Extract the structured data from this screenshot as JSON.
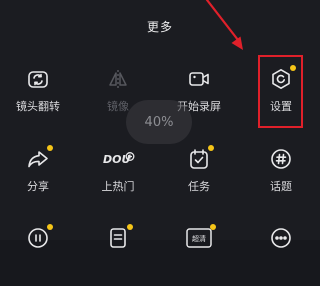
{
  "sheet": {
    "title": "更多"
  },
  "overlay": {
    "progress": "40%"
  },
  "row1": [
    {
      "label": "镜头翻转",
      "icon": "camera-flip-icon",
      "enabled": true
    },
    {
      "label": "镜像",
      "icon": "mirror-icon",
      "enabled": false
    },
    {
      "label": "开始录屏",
      "icon": "screen-record-icon",
      "enabled": true
    },
    {
      "label": "设置",
      "icon": "settings-hexagon-icon",
      "enabled": true,
      "badge": true
    }
  ],
  "row2": [
    {
      "label": "分享",
      "icon": "share-arrow-icon",
      "badge": true
    },
    {
      "label": "上热门",
      "icon": "dou-plus-icon",
      "icon_text": "DOU"
    },
    {
      "label": "任务",
      "icon": "task-calendar-icon",
      "badge": true
    },
    {
      "label": "话题",
      "icon": "hashtag-icon"
    }
  ],
  "row3": [
    {
      "icon": "pause-circle-icon",
      "badge": true
    },
    {
      "icon": "list-doc-icon",
      "badge": true
    },
    {
      "icon": "screen-tile-icon",
      "icon_text": "超清",
      "badge": true
    },
    {
      "icon": "more-dots-icon"
    }
  ],
  "colors": {
    "background": "#1b1c21",
    "badge": "#f5c518",
    "highlight": "#e0202a"
  }
}
